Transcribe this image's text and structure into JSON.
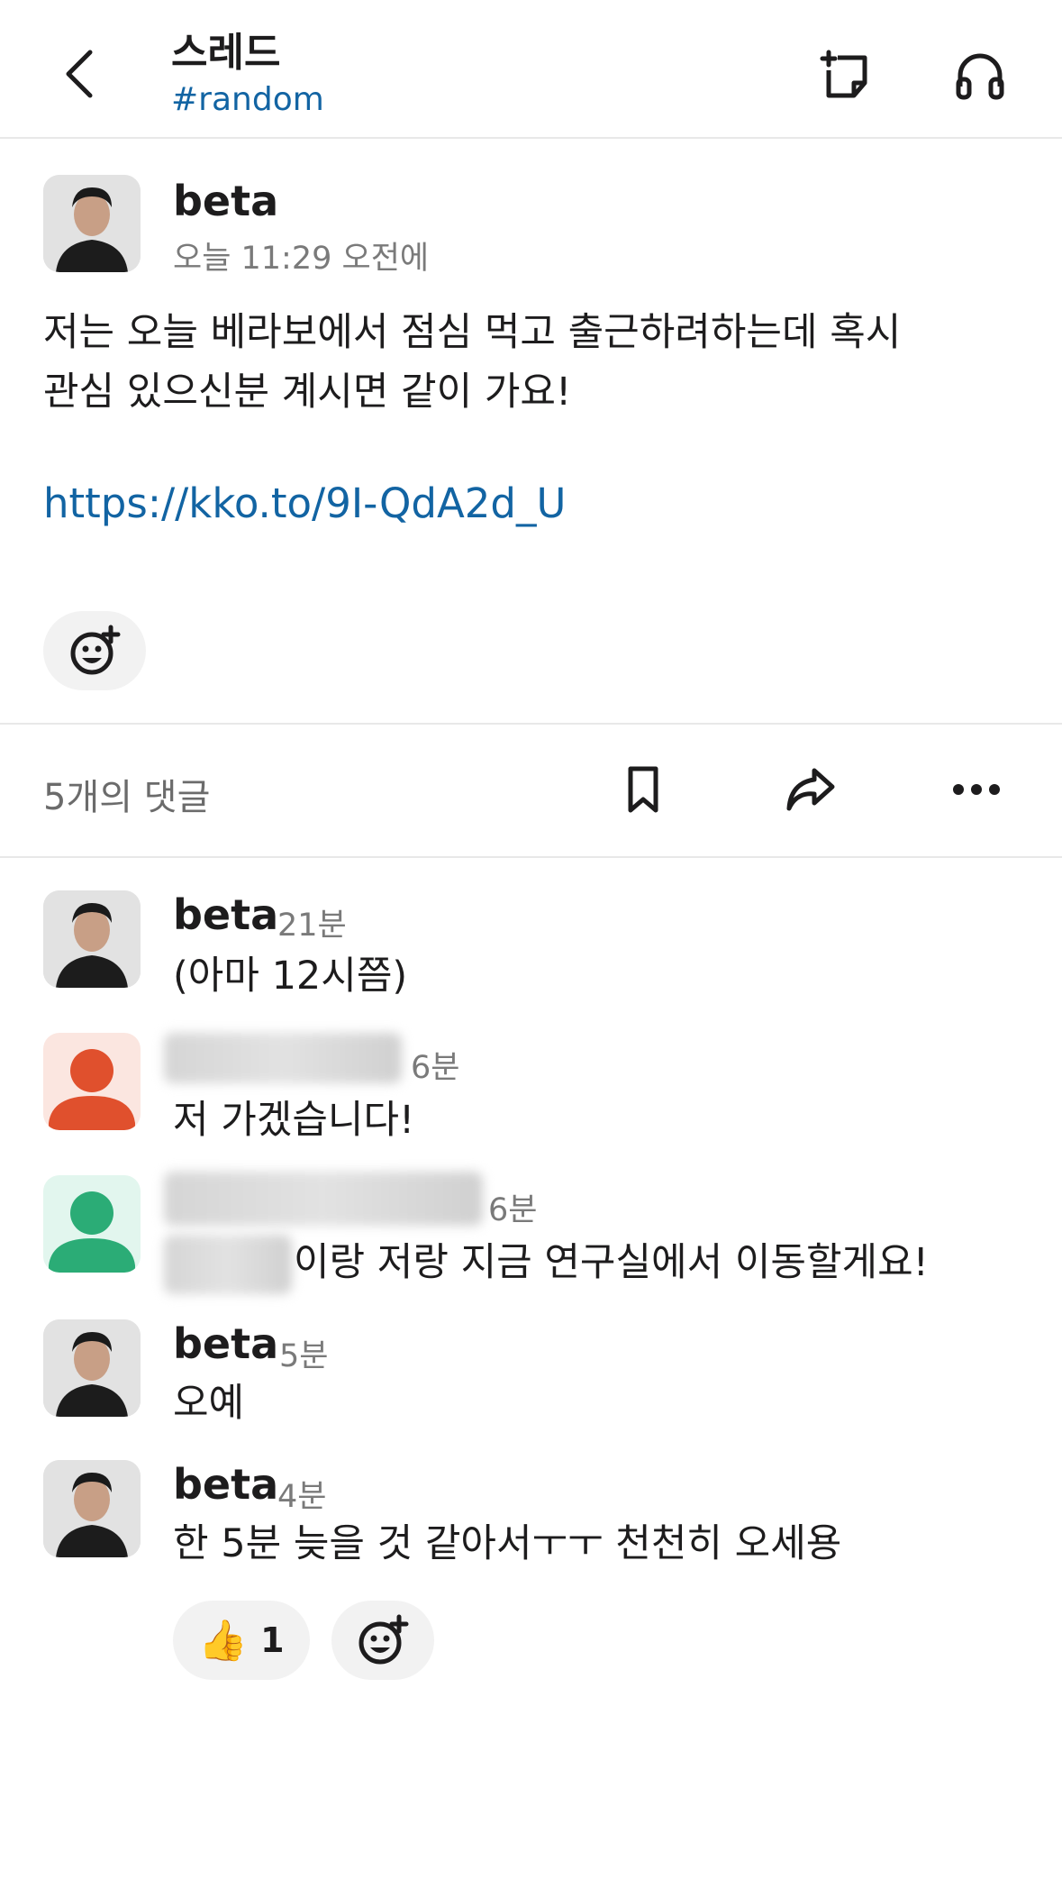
{
  "header": {
    "title": "스레드",
    "channel": "#random"
  },
  "parent": {
    "author": "beta",
    "time": "오늘 11:29 오전에",
    "line1": "저는 오늘 베라보에서 점심 먹고 출근하려하는데 혹시",
    "line2": "관심 있으신분 계시면 같이 가요!",
    "link": "https://kko.to/9I-QdA2d_U"
  },
  "actions": {
    "reply_count": "5개의 댓글"
  },
  "replies": [
    {
      "author": "beta",
      "time": "21분",
      "text": "(아마 12시쯤)"
    },
    {
      "author": "",
      "time": "6분",
      "text": "저 가겠습니다!"
    },
    {
      "author": "",
      "time": "6분",
      "text": "이랑 저랑 지금 연구실에서 이동할게요!"
    },
    {
      "author": "beta",
      "time": "5분",
      "text": "오예"
    },
    {
      "author": "beta",
      "time": "4분",
      "text": "한 5분 늦을 것 같아서ㅜㅜ 천천히 오세용"
    }
  ],
  "reaction": {
    "emoji": "👍",
    "count": "1"
  },
  "icons": {
    "back": "chevron-left-icon",
    "new_thread": "new-note-icon",
    "huddle": "headphones-icon",
    "add_reaction": "add-emoji-icon",
    "bookmark": "bookmark-icon",
    "share": "share-icon",
    "more": "more-horizontal-icon"
  },
  "colors": {
    "link": "#1264a3",
    "avatar_orange": "#e0502d",
    "avatar_green": "#2bac76"
  }
}
